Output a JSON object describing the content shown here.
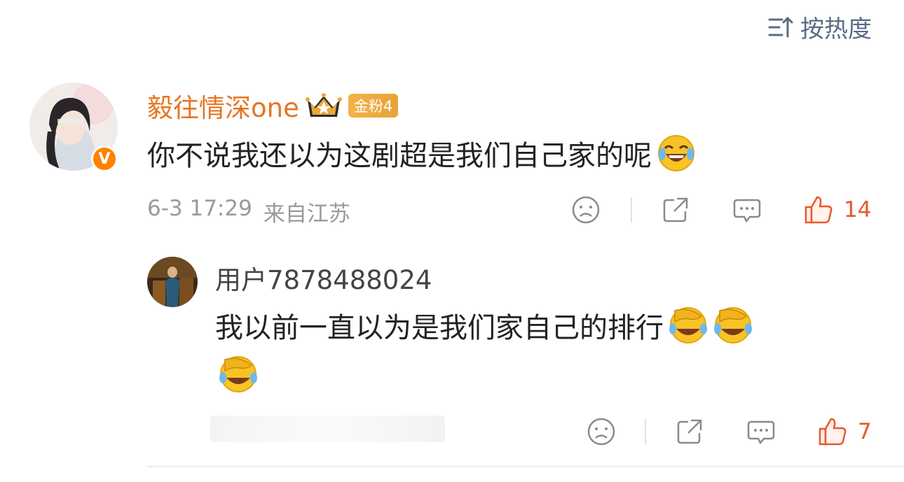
{
  "sort": {
    "label": "按热度",
    "icon": "sort-icon"
  },
  "comment": {
    "username": "毅往情深one",
    "fan_badge": "金粉4",
    "verified_badge": "V",
    "text": "你不说我还以为这剧超是我们自己家的呢",
    "meta_date": "6-3 17:29",
    "meta_location": "来自江苏",
    "like_count": "14"
  },
  "reply": {
    "username": "用户7878488024",
    "text": "我以前一直以为是我们家自己的排行",
    "like_count": "7"
  },
  "colors": {
    "accent_orange": "#e87420",
    "like_red": "#e8582a",
    "meta_gray": "#9a9a9a",
    "sort_blue": "#5b6b86"
  }
}
